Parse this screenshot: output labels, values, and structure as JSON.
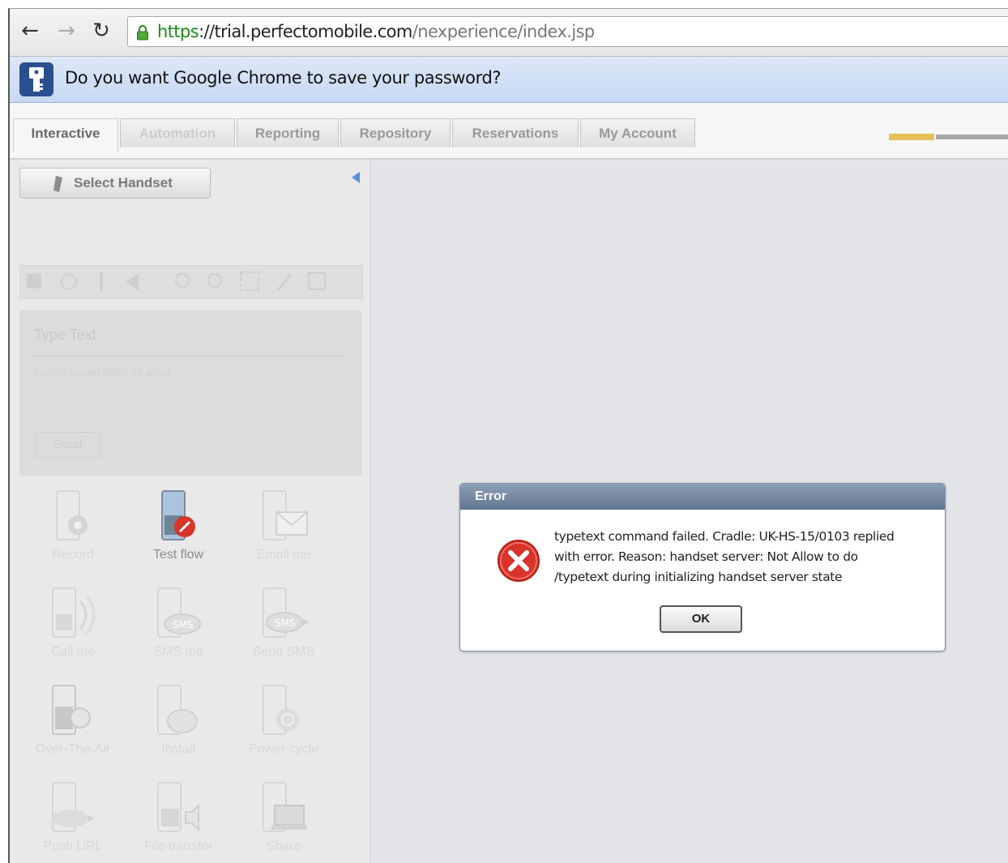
{
  "browser": {
    "url": {
      "scheme": "https",
      "separator": "://",
      "host": "trial.perfectomobile.com",
      "path": "/nexperience/index.jsp"
    },
    "infobar_text": "Do you want Google Chrome to save your password?"
  },
  "tabs": [
    {
      "label": "Interactive",
      "state": "active"
    },
    {
      "label": "Automation",
      "state": "disabled"
    },
    {
      "label": "Reporting",
      "state": "normal"
    },
    {
      "label": "Repository",
      "state": "normal"
    },
    {
      "label": "Reservations",
      "state": "normal"
    },
    {
      "label": "My Account",
      "state": "normal"
    }
  ],
  "left_panel": {
    "select_handset_label": "Select Handset",
    "type_text_title": "Type Text",
    "type_text_placeholder": "Lorem ipsum dolor sit amet",
    "send_label": "Send",
    "actions": [
      {
        "label": "Record",
        "icon": "record-icon"
      },
      {
        "label": "Test flow",
        "icon": "test-flow-icon",
        "highlighted": true
      },
      {
        "label": "Email me",
        "icon": "email-icon"
      },
      {
        "label": "Call me",
        "icon": "call-icon"
      },
      {
        "label": "SMS me",
        "icon": "sms-me-icon"
      },
      {
        "label": "Send SMS",
        "icon": "send-sms-icon"
      },
      {
        "label": "Over-The-Air",
        "icon": "over-the-air-icon"
      },
      {
        "label": "Install",
        "icon": "install-icon"
      },
      {
        "label": "Power cycle",
        "icon": "power-icon"
      },
      {
        "label": "Push URL",
        "icon": "push-url-icon"
      },
      {
        "label": "File transfer",
        "icon": "file-transfer-icon"
      },
      {
        "label": "Share",
        "icon": "share-icon"
      }
    ]
  },
  "dialog": {
    "title": "Error",
    "message_lines": [
      "typetext command failed. Cradle: UK-HS-15/0103 replied",
      "with error. Reason: handset server: Not Allow to do",
      "/typetext during initializing handset server state"
    ],
    "ok_label": "OK"
  },
  "colors": {
    "dialog_title_bar": "#6f829c",
    "error_red": "#d9342b",
    "url_scheme_green": "#1a8a1a",
    "infobar_blue": "#c6d8f3"
  }
}
